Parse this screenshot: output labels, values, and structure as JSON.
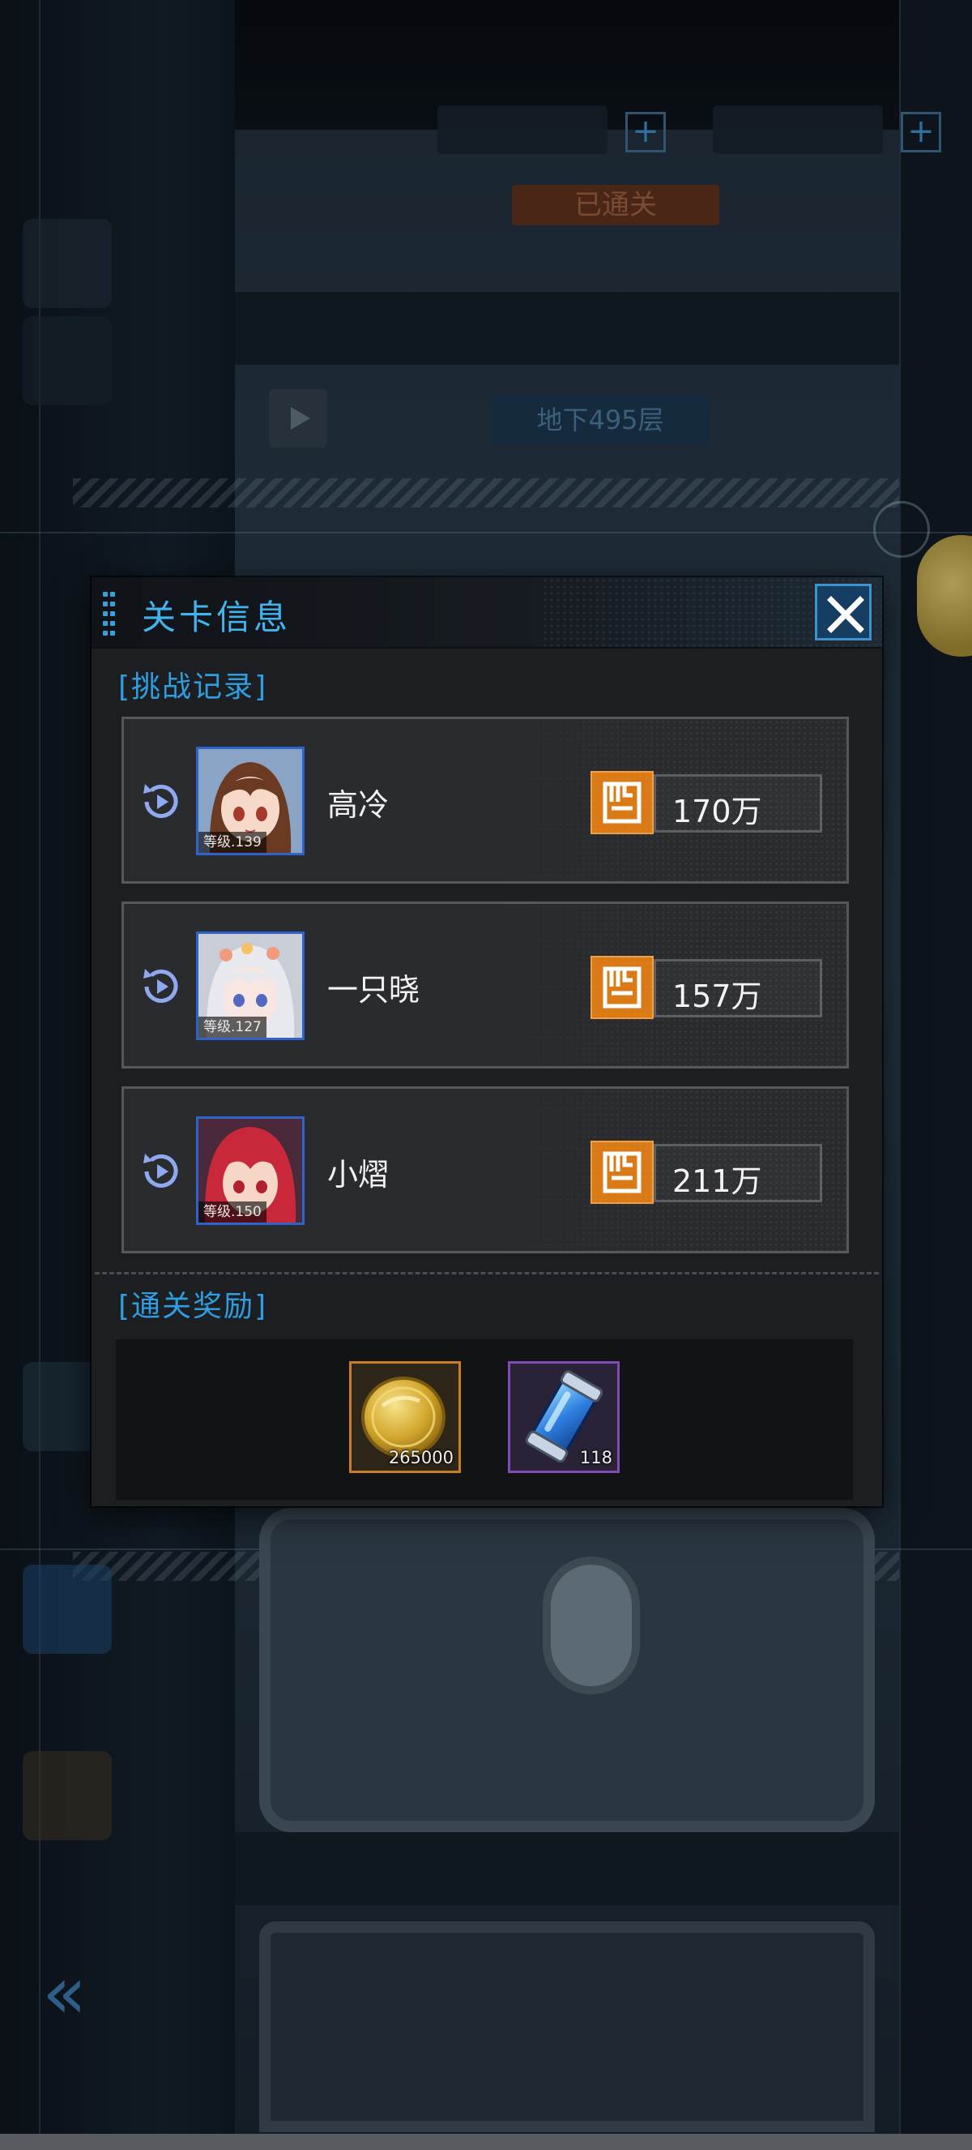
{
  "background": {
    "status_text": "已通关",
    "floor_label": "地下495层"
  },
  "dialog": {
    "title": "关卡信息",
    "close_icon": "close-x-icon",
    "records_section": "挑战记录",
    "rewards_section": "通关奖励",
    "records": [
      {
        "level": "等级.139",
        "name": "高冷",
        "power": "170万"
      },
      {
        "level": "等级.127",
        "name": "一只晓",
        "power": "157万"
      },
      {
        "level": "等级.150",
        "name": "小熠",
        "power": "211万"
      }
    ],
    "rewards": [
      {
        "icon": "gold-coin-icon",
        "count": "265000"
      },
      {
        "icon": "energy-canister-icon",
        "count": "118"
      }
    ]
  },
  "colors": {
    "accent_blue": "#41b4ee",
    "power_orange": "#d97a17",
    "avatar_border": "#2f63c9",
    "gold_frame": "#c97e25",
    "purple_frame": "#7f4bb5"
  }
}
